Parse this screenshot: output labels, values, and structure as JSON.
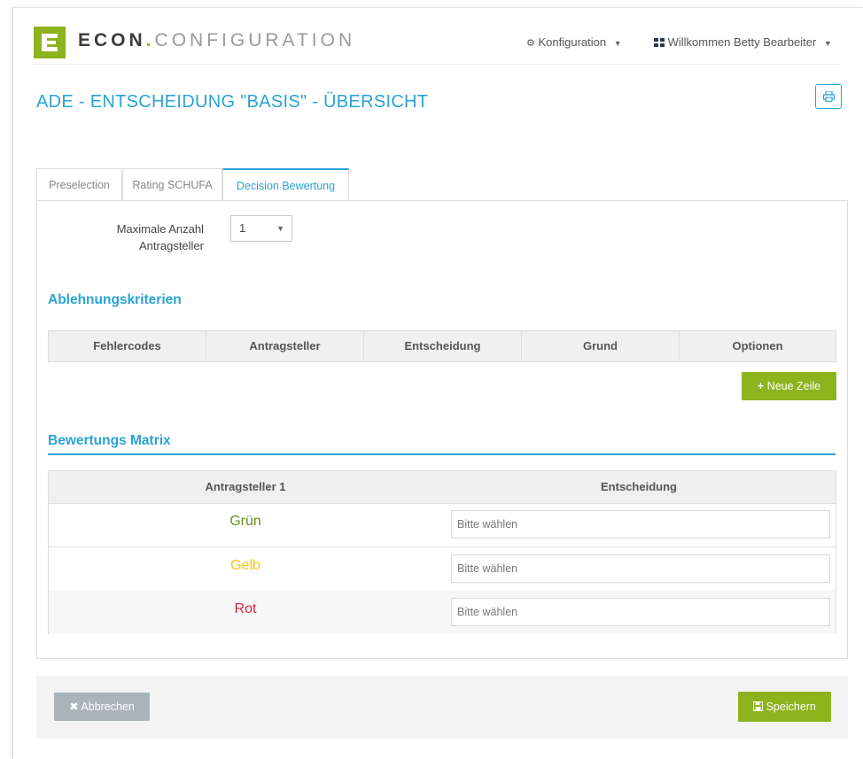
{
  "header": {
    "logo_part1": "ECON",
    "logo_dot": ".",
    "logo_part2": "CONFIGURATION",
    "nav_config": "Konfiguration",
    "nav_user": "Willkommen Betty Bearbeiter",
    "nav_config_icon": "gear-icon",
    "nav_user_icon": "grid-icon"
  },
  "page": {
    "title": "ADE - ENTSCHEIDUNG \"BASIS\" - ÜBERSICHT",
    "print_icon": "print-icon"
  },
  "tabs": [
    {
      "label": "Preselection",
      "active": false
    },
    {
      "label": "Rating SCHUFA",
      "active": false
    },
    {
      "label": "Decision Bewertung",
      "active": true
    }
  ],
  "form": {
    "max_label_line1": "Maximale Anzahl",
    "max_label_line2": "Antragsteller",
    "max_value": "1"
  },
  "ablehnung": {
    "title": "Ablehnungskriterien",
    "columns": [
      "Fehlercodes",
      "Antragsteller",
      "Entscheidung",
      "Grund",
      "Optionen"
    ],
    "add_button": "Neue Zeile"
  },
  "matrix": {
    "title": "Bewertungs Matrix",
    "col1": "Antragsteller 1",
    "col2": "Entscheidung",
    "rows": [
      {
        "label": "Grün",
        "color": "#6b8e23",
        "placeholder": "Bitte wählen"
      },
      {
        "label": "Gelb",
        "color": "#f5c518",
        "placeholder": "Bitte wählen"
      },
      {
        "label": "Rot",
        "color": "#d9263b",
        "placeholder": "Bitte wählen"
      }
    ]
  },
  "footer": {
    "cancel": "Abbrechen",
    "save": "Speichern"
  },
  "colors": {
    "accent": "#2aa3d4",
    "brand_green": "#8db31d",
    "cancel_grey": "#a9b3ba"
  }
}
